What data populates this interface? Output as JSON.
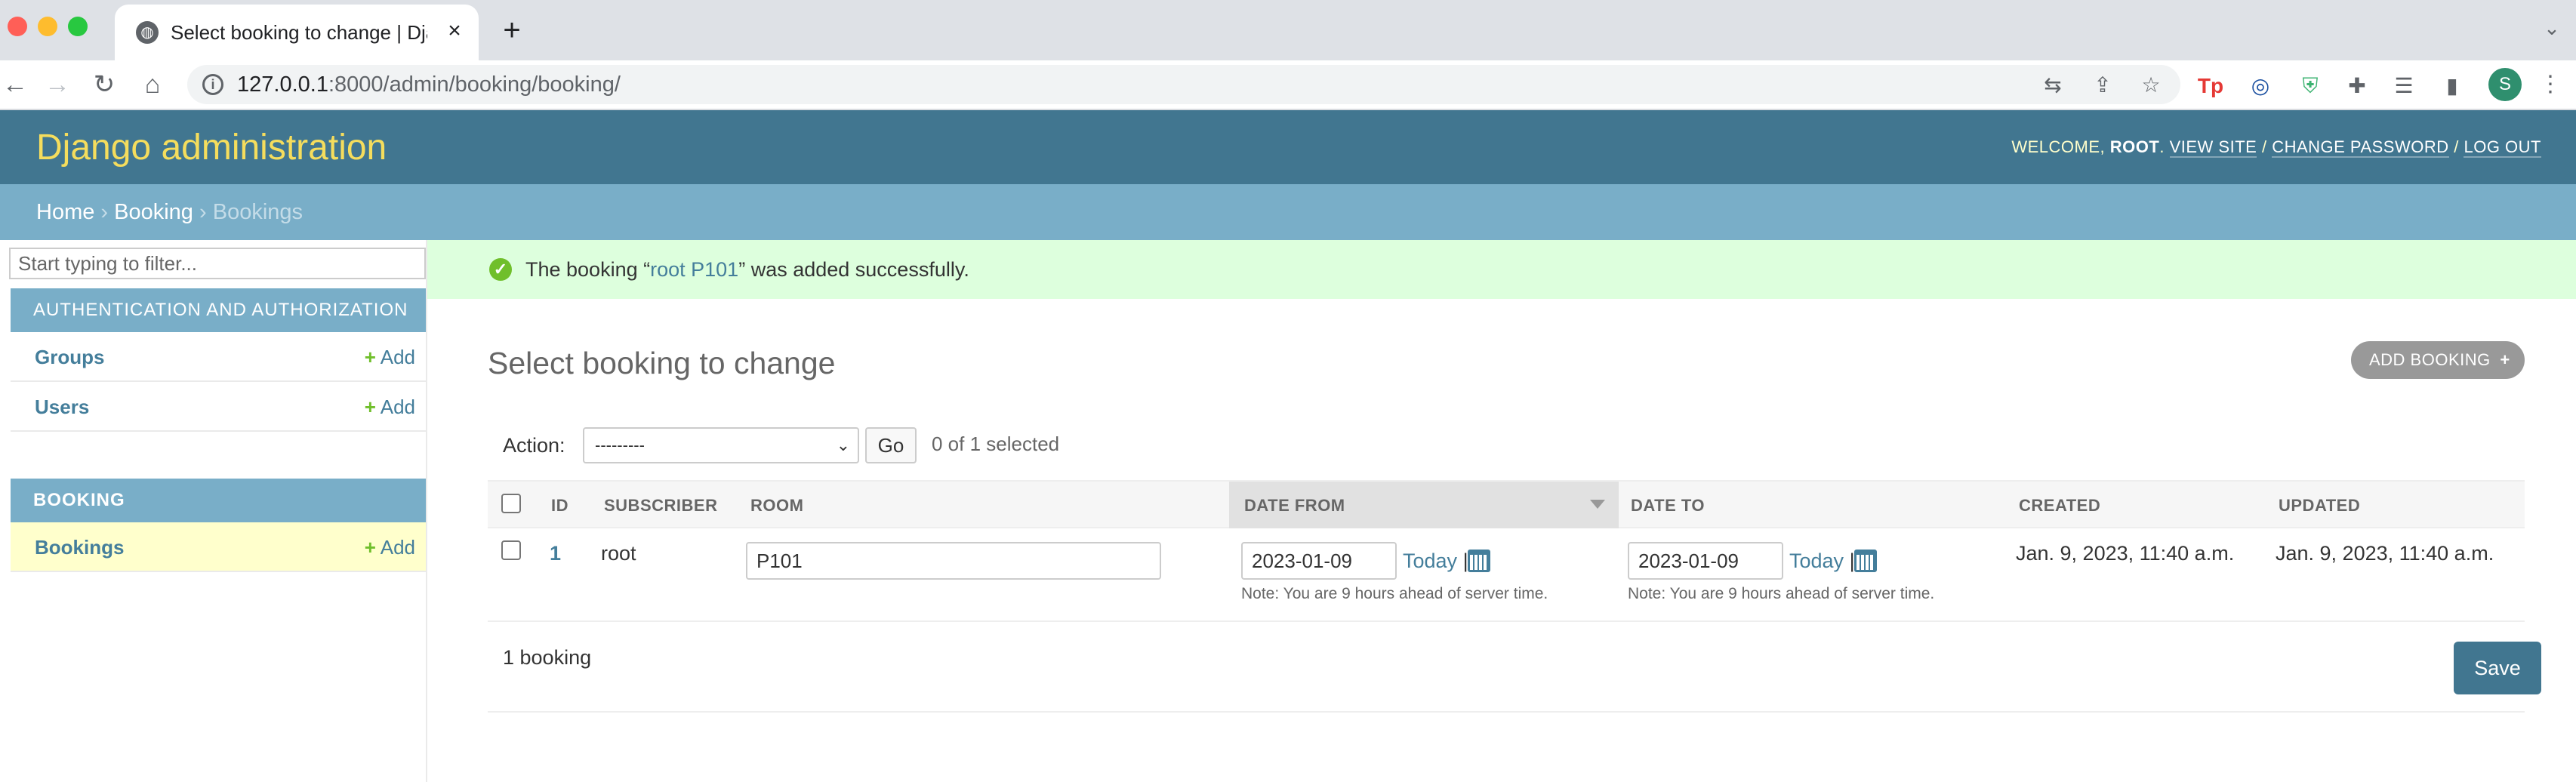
{
  "browser": {
    "tab_title": "Select booking to change | Django site admin",
    "url_host": "127.0.0.1",
    "url_rest": ":8000/admin/booking/booking/",
    "profile_initial": "S"
  },
  "header": {
    "branding": "Django administration",
    "welcome": "WELCOME,",
    "username": "ROOT",
    "view_site": "VIEW SITE",
    "change_password": "CHANGE PASSWORD",
    "log_out": "LOG OUT",
    "separator": " / "
  },
  "breadcrumbs": {
    "home": "Home",
    "app": "Booking",
    "current": "Bookings",
    "sep": " › "
  },
  "sidebar": {
    "filter_placeholder": "Start typing to filter...",
    "add_label": "Add",
    "modules": [
      {
        "caption": "AUTHENTICATION AND AUTHORIZATION",
        "models": [
          "Groups",
          "Users"
        ]
      },
      {
        "caption": "BOOKING",
        "models": [
          "Bookings"
        ]
      }
    ]
  },
  "message": {
    "prefix": "The booking “",
    "link": "root P101",
    "suffix": "” was added successfully."
  },
  "content": {
    "title": "Select booking to change",
    "add_button": "ADD BOOKING",
    "action_label": "Action:",
    "action_value": "---------",
    "go_label": "Go",
    "selected_count": "0 of 1 selected"
  },
  "table": {
    "columns": [
      "ID",
      "SUBSCRIBER",
      "ROOM",
      "DATE FROM",
      "DATE TO",
      "CREATED",
      "UPDATED"
    ],
    "rows": [
      {
        "id": "1",
        "subscriber": "root",
        "room": "P101",
        "date_from": "2023-01-09",
        "date_to": "2023-01-09",
        "created": "Jan. 9, 2023, 11:40 a.m.",
        "updated": "Jan. 9, 2023, 11:40 a.m."
      }
    ],
    "today_label": "Today",
    "note": "Note: You are 9 hours ahead of server time.",
    "count_label": "1 booking",
    "save_label": "Save"
  },
  "colors": {
    "header_bg": "#417690",
    "branding": "#f5dd5d",
    "breadcrumbs_bg": "#79aec8",
    "link": "#447e9b",
    "success_bg": "#ddffdd",
    "selected_row_bg": "#ffffcc"
  }
}
